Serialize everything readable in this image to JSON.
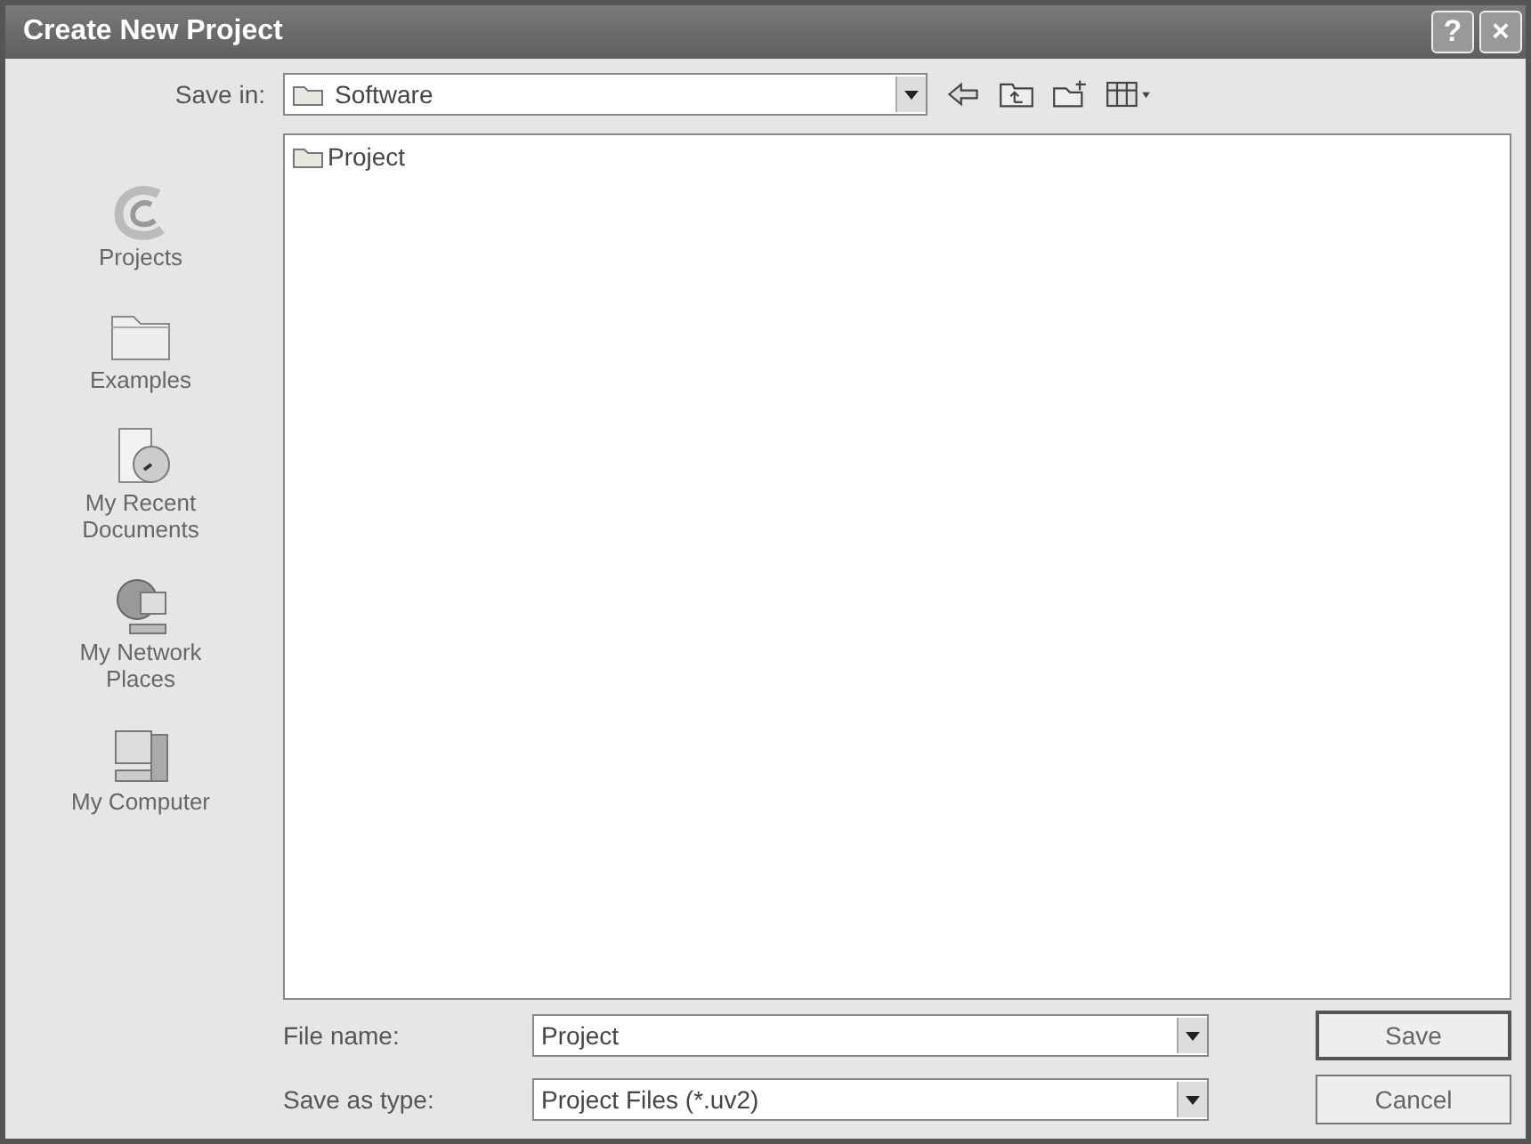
{
  "window": {
    "title": "Create New Project",
    "help_button": "?",
    "close_button": "×"
  },
  "save_in": {
    "label": "Save in:",
    "value": "Software"
  },
  "places": [
    {
      "kind": "projects",
      "label": "Projects",
      "selected": false
    },
    {
      "kind": "folder",
      "label": "Examples",
      "selected": false
    },
    {
      "kind": "recent",
      "label": "My Recent Documents",
      "selected": false
    },
    {
      "kind": "network",
      "label": "My Network Places",
      "selected": false
    },
    {
      "kind": "computer",
      "label": "My Computer",
      "selected": false
    }
  ],
  "files": [
    {
      "name": "Project",
      "selected": false
    }
  ],
  "file_name": {
    "label": "File name:",
    "value": "Project"
  },
  "save_as_type": {
    "label": "Save as type:",
    "value": "Project Files (*.uv2)"
  },
  "buttons": [
    "Save",
    "Cancel"
  ]
}
